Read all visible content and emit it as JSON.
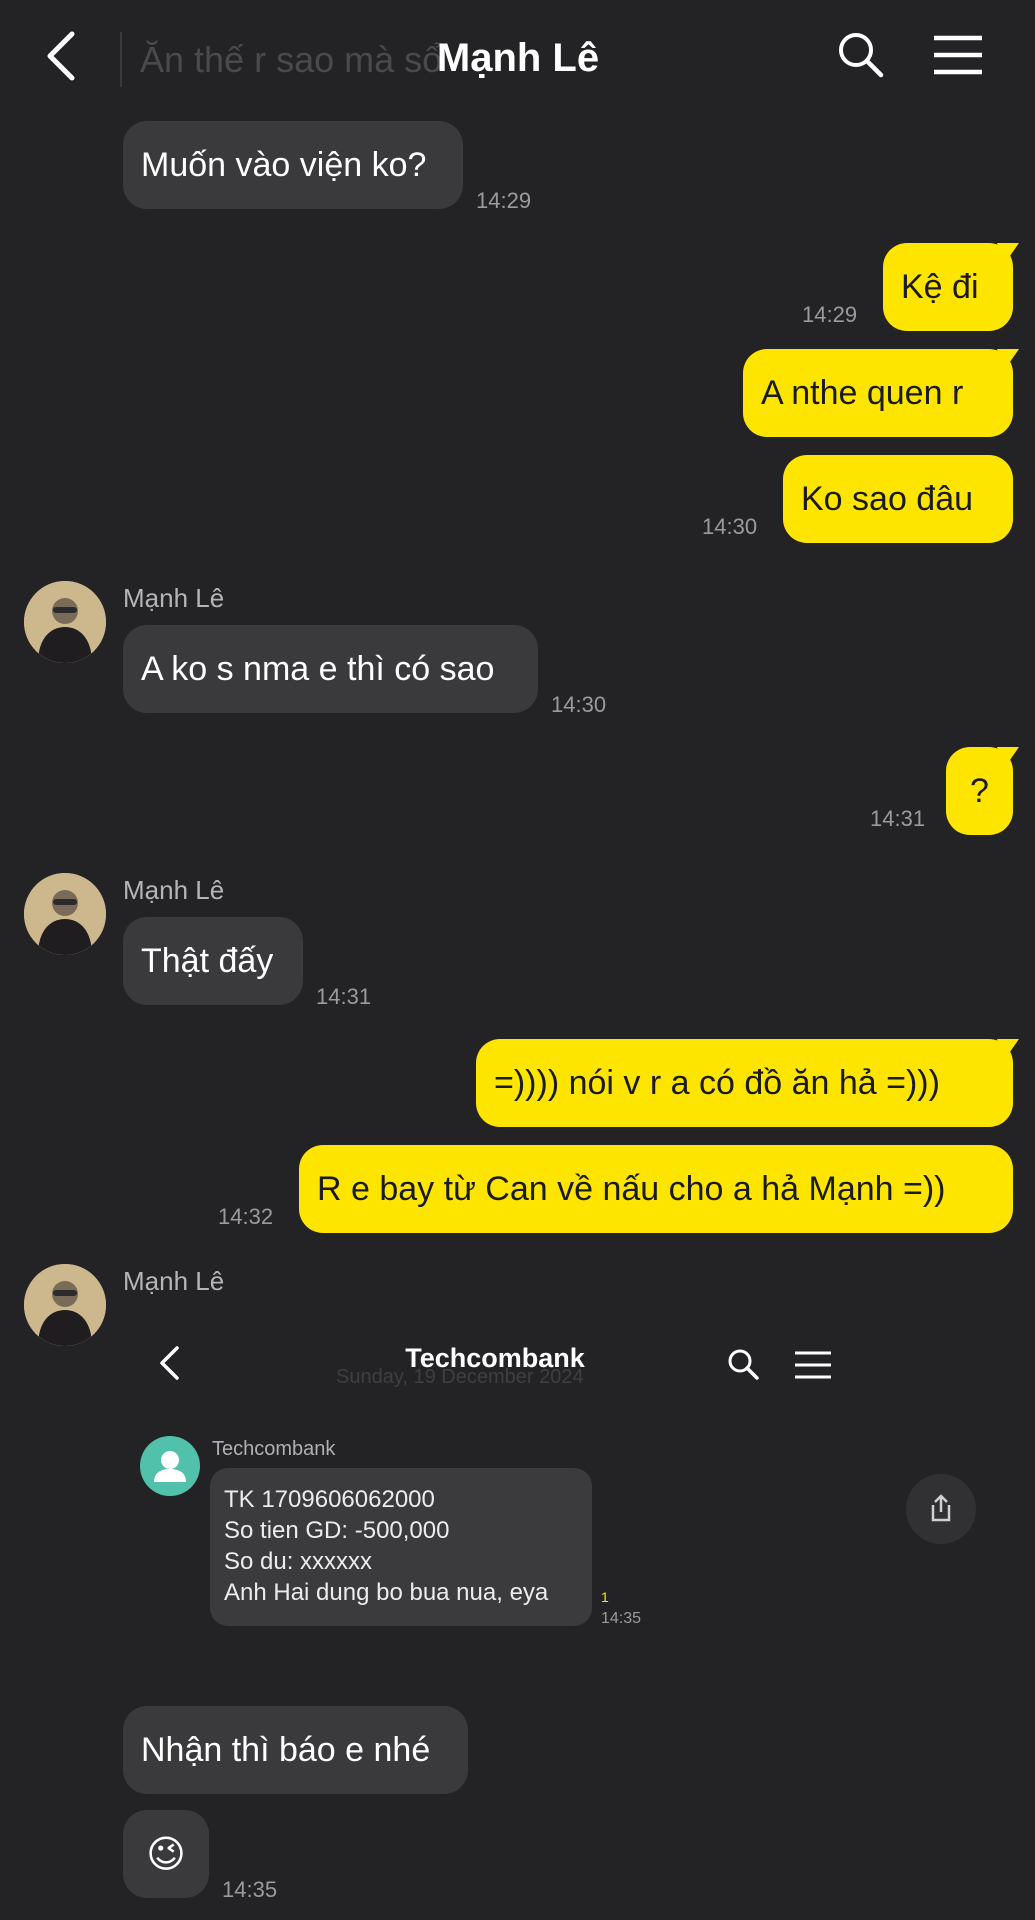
{
  "header": {
    "title": "Mạnh Lê",
    "ghost_preview": "Ăn thế r sao mà sổ",
    "back_icon": "chevron-left-icon",
    "search_icon": "search-icon",
    "menu_icon": "menu-icon"
  },
  "colors": {
    "background": "#232325",
    "incoming_bubble": "#3a3a3d",
    "outgoing_bubble": "#fee500",
    "timestamp": "#9b9b9f"
  },
  "messages": [
    {
      "dir": "in",
      "text": "Muốn vào viện ko?",
      "time": "14:29"
    },
    {
      "dir": "out",
      "text": "Kệ đi",
      "time": "14:29"
    },
    {
      "dir": "out",
      "text": "A nthe quen r",
      "time": ""
    },
    {
      "dir": "out",
      "text": "Ko sao đâu",
      "time": "14:30"
    },
    {
      "dir": "in",
      "sender": "Mạnh Lê",
      "text": "A ko s nma e thì có sao",
      "time": "14:30"
    },
    {
      "dir": "out",
      "text": "?",
      "time": "14:31"
    },
    {
      "dir": "in",
      "sender": "Mạnh Lê",
      "text": "Thật đấy",
      "time": "14:31"
    },
    {
      "dir": "out",
      "text": "=)))) nói v r a có đồ ăn hả =)))",
      "time": ""
    },
    {
      "dir": "out",
      "text": "R e bay từ Can về nấu cho a hả Mạnh =))",
      "time": "14:32"
    },
    {
      "dir": "in",
      "sender": "Mạnh Lê",
      "text": "Nhận thì báo e nhé",
      "time": ""
    },
    {
      "dir": "in",
      "text": "😉",
      "time": "14:35"
    }
  ],
  "shared_screenshot": {
    "title": "Techcombank",
    "ghost_date": "Sunday, 19 December 2024",
    "sender": "Techcombank",
    "sms_lines": [
      "TK 1709606062000",
      "So tien GD: -500,000",
      "So du: xxxxxx",
      "Anh Hai dung bo bua nua, eya"
    ],
    "unread_count": "1",
    "time": "14:35",
    "share_icon": "share-icon"
  }
}
